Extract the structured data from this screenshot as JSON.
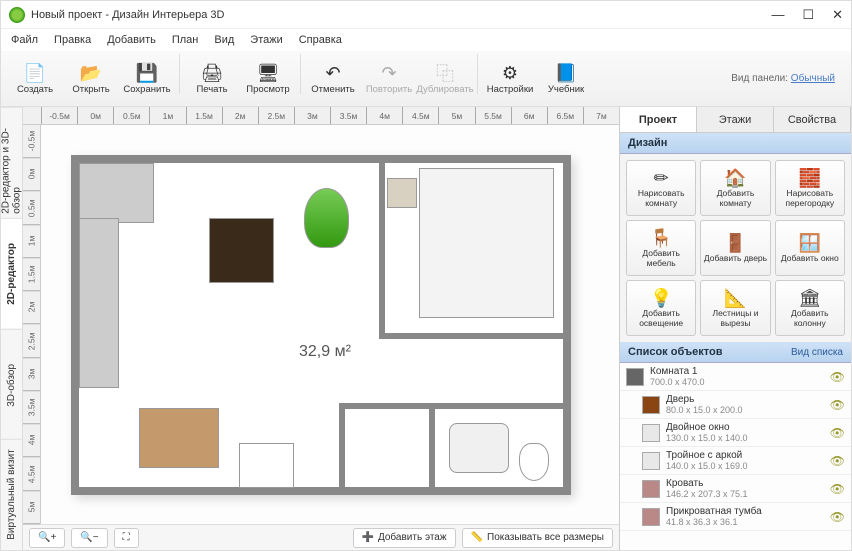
{
  "title": "Новый проект - Дизайн Интерьера 3D",
  "menu": [
    "Файл",
    "Правка",
    "Добавить",
    "План",
    "Вид",
    "Этажи",
    "Справка"
  ],
  "toolbar": [
    {
      "label": "Создать",
      "icon": "📄"
    },
    {
      "label": "Открыть",
      "icon": "📂"
    },
    {
      "label": "Сохранить",
      "icon": "💾"
    },
    {
      "label": "Печать",
      "icon": "🖨"
    },
    {
      "label": "Просмотр",
      "icon": "🖥"
    },
    {
      "label": "Отменить",
      "icon": "↶"
    },
    {
      "label": "Повторить",
      "icon": "↷",
      "disabled": true
    },
    {
      "label": "Дублировать",
      "icon": "⿻",
      "disabled": true
    },
    {
      "label": "Настройки",
      "icon": "⚙"
    },
    {
      "label": "Учебник",
      "icon": "📘"
    }
  ],
  "panel_mode_label": "Вид панели:",
  "panel_mode_value": "Обычный",
  "vtabs": [
    "2D-редактор и 3D-обзор",
    "2D-редактор",
    "3D-обзор",
    "Виртуальный визит"
  ],
  "vtabs_active": 1,
  "ruler_h": [
    "-0.5м",
    "0м",
    "0.5м",
    "1м",
    "1.5м",
    "2м",
    "2.5м",
    "3м",
    "3.5м",
    "4м",
    "4.5м",
    "5м",
    "5.5м",
    "6м",
    "6.5м",
    "7м"
  ],
  "ruler_v": [
    "-0.5м",
    "0м",
    "0.5м",
    "1м",
    "1.5м",
    "2м",
    "2.5м",
    "3м",
    "3.5м",
    "4м",
    "4.5м",
    "5м"
  ],
  "room_area": "32,9 м²",
  "bottom": {
    "zoom_in": "+",
    "zoom_out": "−",
    "zoom_fit": "⛶",
    "add_floor": "Добавить этаж",
    "show_all": "Показывать все размеры"
  },
  "sp_tabs": [
    "Проект",
    "Этажи",
    "Свойства"
  ],
  "sp_tabs_active": 0,
  "sp_design_header": "Дизайн",
  "design_items": [
    {
      "label": "Нарисовать комнату",
      "icon": "✏"
    },
    {
      "label": "Добавить комнату",
      "icon": "🏠"
    },
    {
      "label": "Нарисовать перегородку",
      "icon": "🧱"
    },
    {
      "label": "Добавить мебель",
      "icon": "🪑"
    },
    {
      "label": "Добавить дверь",
      "icon": "🚪"
    },
    {
      "label": "Добавить окно",
      "icon": "🪟"
    },
    {
      "label": "Добавить освещение",
      "icon": "💡"
    },
    {
      "label": "Лестницы и вырезы",
      "icon": "📐"
    },
    {
      "label": "Добавить колонну",
      "icon": "🏛"
    }
  ],
  "sp_objlist_header": "Список объектов",
  "sp_objlist_viewlink": "Вид списка",
  "objects": [
    {
      "name": "Комната 1",
      "dims": "700.0 x 470.0",
      "cls": "room",
      "indent": false
    },
    {
      "name": "Дверь",
      "dims": "80.0 x 15.0 x 200.0",
      "cls": "door",
      "indent": true
    },
    {
      "name": "Двойное окно",
      "dims": "130.0 x 15.0 x 140.0",
      "cls": "window",
      "indent": true
    },
    {
      "name": "Тройное с аркой",
      "dims": "140.0 x 15.0 x 169.0",
      "cls": "window",
      "indent": true
    },
    {
      "name": "Кровать",
      "dims": "146.2 x 207.3 x 75.1",
      "cls": "bed",
      "indent": true
    },
    {
      "name": "Прикроватная тумба",
      "dims": "41.8 x 36.3 x 36.1",
      "cls": "bed",
      "indent": true
    }
  ]
}
